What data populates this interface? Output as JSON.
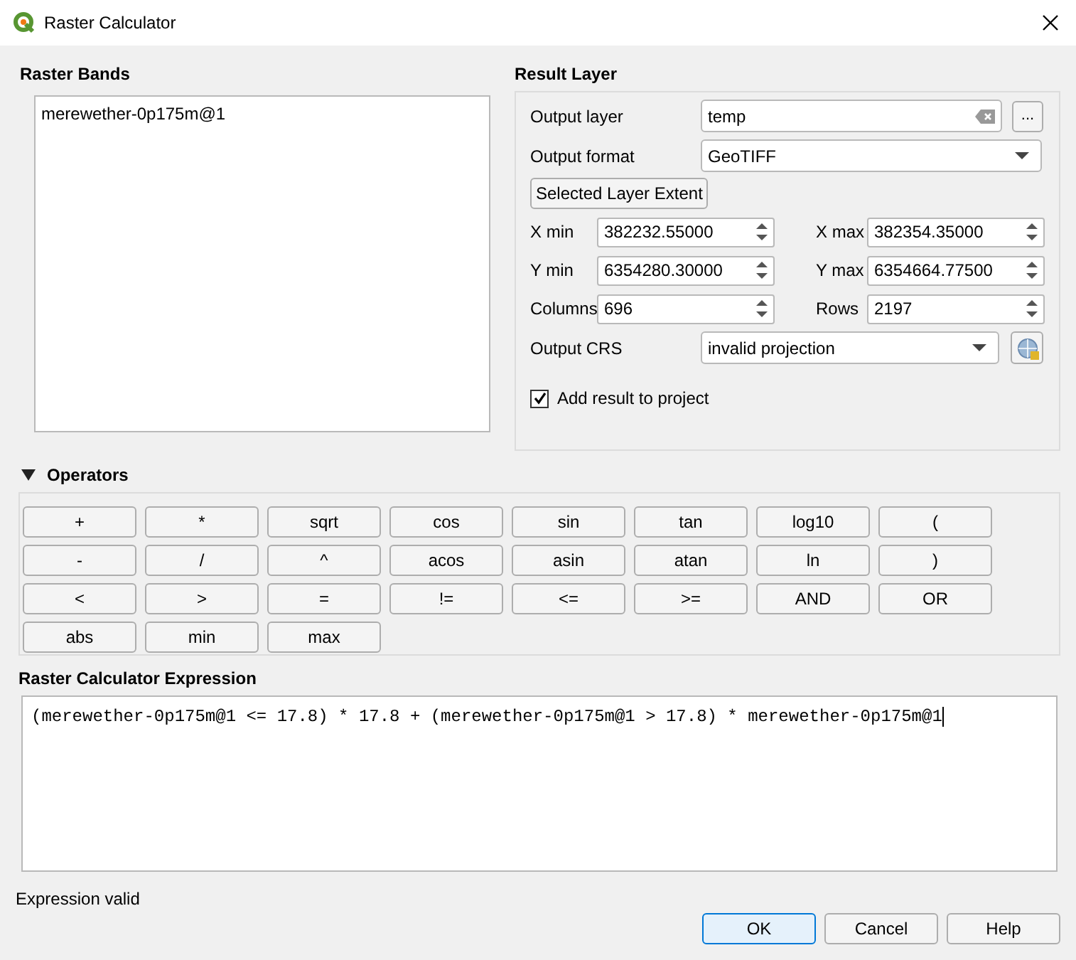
{
  "window": {
    "title": "Raster Calculator"
  },
  "raster_bands": {
    "title": "Raster Bands",
    "items": [
      {
        "label": "merewether-0p175m@1"
      }
    ]
  },
  "result_layer": {
    "title": "Result Layer",
    "output_layer": {
      "label": "Output layer",
      "value": "temp",
      "browse": "..."
    },
    "output_format": {
      "label": "Output format",
      "value": "GeoTIFF"
    },
    "extent_button": "Selected Layer Extent",
    "extents": [
      {
        "label": "X min",
        "value": "382232.55000"
      },
      {
        "label": "X max",
        "value": "382354.35000"
      },
      {
        "label": "Y min",
        "value": "6354280.30000"
      },
      {
        "label": "Y max",
        "value": "6354664.77500"
      },
      {
        "label": "Columns",
        "value": "696"
      },
      {
        "label": "Rows",
        "value": "2197"
      }
    ],
    "output_crs": {
      "label": "Output CRS",
      "value": "invalid projection"
    },
    "add_to_project": {
      "label": "Add result to project",
      "checked": true
    }
  },
  "operators": {
    "title": "Operators",
    "expanded": true,
    "buttons": [
      "+",
      "*",
      "sqrt",
      "cos",
      "sin",
      "tan",
      "log10",
      "(",
      "-",
      "/",
      "^",
      "acos",
      "asin",
      "atan",
      "ln",
      ")",
      "<",
      ">",
      "=",
      "!=",
      "<=",
      ">=",
      "AND",
      "OR",
      "abs",
      "min",
      "max"
    ]
  },
  "expression": {
    "title": "Raster Calculator Expression",
    "value": "(merewether-0p175m@1 <= 17.8) * 17.8 + (merewether-0p175m@1 > 17.8) * merewether-0p175m@1"
  },
  "status": "Expression valid",
  "buttons": [
    {
      "label": "OK",
      "default": true
    },
    {
      "label": "Cancel",
      "default": false
    },
    {
      "label": "Help",
      "default": false
    }
  ]
}
